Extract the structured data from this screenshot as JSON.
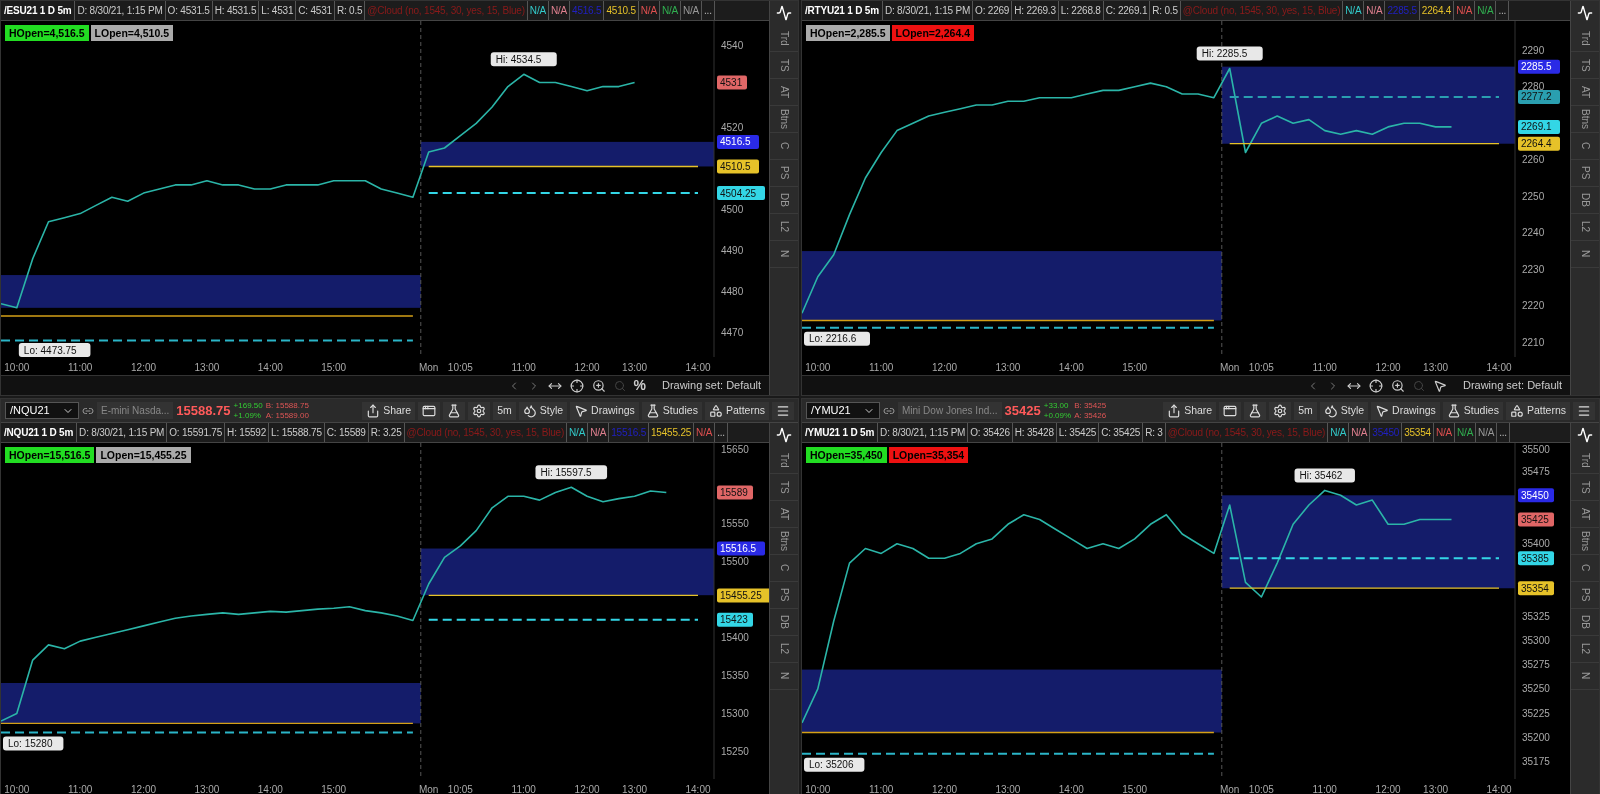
{
  "panels": [
    {
      "info": {
        "symbol": "/ESU21 1 D 5m",
        "items": [
          {
            "text": "D: 8/30/21, 1:15 PM",
            "color": "#cccccc"
          },
          {
            "text": "O: 4531.5",
            "color": "#cccccc"
          },
          {
            "text": "H: 4531.5",
            "color": "#cccccc"
          },
          {
            "text": "L: 4531",
            "color": "#cccccc"
          },
          {
            "text": "C: 4531",
            "color": "#cccccc"
          },
          {
            "text": "R: 0.5",
            "color": "#cccccc"
          },
          {
            "text": "@Cloud (no, 1545, 30, yes, 15, Blue)",
            "color": "#8b1a1a"
          },
          {
            "text": "N/A",
            "color": "#33cccc"
          },
          {
            "text": "N/A",
            "color": "#e08090"
          },
          {
            "text": "4516.5",
            "color": "#2020c0"
          },
          {
            "text": "4510.5",
            "color": "#e6c229"
          },
          {
            "text": "N/A",
            "color": "#e05050"
          },
          {
            "text": "N/A",
            "color": "#30b050"
          },
          {
            "text": "N/A",
            "color": "#999999"
          },
          {
            "text": "..."
          }
        ]
      },
      "badges": [
        {
          "text": "HOpen=4,516.5",
          "color": "#22dd22"
        },
        {
          "text": "LOpen=4,510.5",
          "color": "#aaaaaa"
        }
      ],
      "price_tag": {
        "text": "4531",
        "color": "#e06666"
      },
      "chart_data": {
        "type": "line",
        "categories": [
          null,
          "10:00",
          null,
          null,
          null,
          "11:00",
          null,
          null,
          null,
          "12:00",
          null,
          null,
          null,
          "13:00",
          null,
          null,
          null,
          "14:00",
          null,
          null,
          null,
          "15:00",
          null,
          null,
          null,
          null,
          null,
          "Mon",
          null,
          "10:05",
          null,
          null,
          null,
          "11:00",
          null,
          null,
          null,
          "12:00",
          null,
          null,
          "13:00",
          null,
          null,
          null,
          "14:00"
        ],
        "series": [
          {
            "color": "#2bb5a8",
            "values": [
              4477,
              4476,
              4488,
              4497,
              4498,
              4499,
              4501,
              4503,
              4502,
              4504,
              4505,
              4506,
              4506,
              4507,
              4506,
              4506,
              4505,
              4505,
              4506,
              4506,
              4506,
              4507,
              4507,
              4507,
              4505,
              4504,
              4503,
              4514,
              4515,
              4518,
              4521,
              4525,
              4530,
              4533,
              4531,
              4531,
              4530,
              4529,
              4530,
              4530,
              4531,
              null,
              null,
              null,
              null
            ]
          },
          {
            "color": "#d4a017",
            "values": [
              4474,
              4474,
              4474,
              4474,
              4474,
              4474,
              4474,
              4474,
              4474,
              4474,
              4474,
              4474,
              4474,
              4474,
              4474,
              4474,
              4474,
              4474,
              4474,
              4474,
              4474,
              4474,
              4474,
              4474,
              4474,
              4474,
              4474,
              null,
              null,
              null,
              null,
              null,
              null,
              null,
              null,
              null,
              null,
              null,
              null,
              null,
              null,
              null,
              null,
              null,
              null
            ]
          },
          {
            "color": "#2bb5c8",
            "line_style": "dashed",
            "values": [
              4468,
              4468,
              4468,
              4468,
              4468,
              4468,
              4468,
              4468,
              4468,
              4468,
              4468,
              4468,
              4468,
              4468,
              4468,
              4468,
              4468,
              4468,
              4468,
              4468,
              4468,
              4468,
              4468,
              4468,
              4468,
              4468,
              4468,
              null,
              null,
              null,
              null,
              null,
              null,
              null,
              null,
              null,
              null,
              null,
              null,
              null,
              null,
              null,
              null,
              null,
              null
            ]
          },
          {
            "color": "#e6c229",
            "values": [
              null,
              null,
              null,
              null,
              null,
              null,
              null,
              null,
              null,
              null,
              null,
              null,
              null,
              null,
              null,
              null,
              null,
              null,
              null,
              null,
              null,
              null,
              null,
              null,
              null,
              null,
              null,
              4510.5,
              4510.5,
              4510.5,
              4510.5,
              4510.5,
              4510.5,
              4510.5,
              4510.5,
              4510.5,
              4510.5,
              4510.5,
              4510.5,
              4510.5,
              4510.5,
              4510.5,
              4510.5,
              4510.5,
              4510.5
            ]
          },
          {
            "color": "#33d6e6",
            "line_style": "dashed",
            "values": [
              null,
              null,
              null,
              null,
              null,
              null,
              null,
              null,
              null,
              null,
              null,
              null,
              null,
              null,
              null,
              null,
              null,
              null,
              null,
              null,
              null,
              null,
              null,
              null,
              null,
              null,
              null,
              4504,
              4504,
              4504,
              4504,
              4504,
              4504,
              4504,
              4504,
              4504,
              4504,
              4504,
              4504,
              4504,
              4504,
              4504,
              4504,
              4504,
              4504
            ]
          }
        ],
        "ylim": [
          4464,
          4546
        ],
        "yticks": [
          4470,
          4480,
          4490,
          4500,
          4520,
          4540
        ],
        "bands": [
          {
            "axis": "y",
            "from": 4476,
            "to": 4484
          },
          {
            "axis": "y",
            "from": 4510.5,
            "to": 4516.5
          }
        ],
        "annotations": [
          "Hi: 4534.5",
          "Lo: 4473.75",
          "4516.5",
          "4510.5",
          "4504.25"
        ]
      },
      "side_tabs": [
        "Trd",
        "TS",
        "AT",
        "Btns",
        "C",
        "PS",
        "DB",
        "L2",
        "N"
      ],
      "footer": {
        "symbol": "%",
        "label": "Drawing set: Default"
      }
    },
    {
      "info": {
        "symbol": "/RTYU21 1 D 5m",
        "items": [
          {
            "text": "D: 8/30/21, 1:15 PM",
            "color": "#cccccc"
          },
          {
            "text": "O: 2269",
            "color": "#cccccc"
          },
          {
            "text": "H: 2269.3",
            "color": "#cccccc"
          },
          {
            "text": "L: 2268.8",
            "color": "#cccccc"
          },
          {
            "text": "C: 2269.1",
            "color": "#cccccc"
          },
          {
            "text": "R: 0.5",
            "color": "#cccccc"
          },
          {
            "text": "@Cloud (no, 1545, 30, yes, 15, Blue)",
            "color": "#8b1a1a"
          },
          {
            "text": "N/A",
            "color": "#33cccc"
          },
          {
            "text": "N/A",
            "color": "#e08090"
          },
          {
            "text": "2285.5",
            "color": "#2020c0"
          },
          {
            "text": "2264.4",
            "color": "#e6c229"
          },
          {
            "text": "N/A",
            "color": "#e05050"
          },
          {
            "text": "N/A",
            "color": "#30b050"
          },
          {
            "text": "..."
          }
        ]
      },
      "badges": [
        {
          "text": "HOpen=2,285.5",
          "color": "#aaaaaa"
        },
        {
          "text": "LOpen=2,264.4",
          "color": "#ee1111"
        }
      ],
      "price_tag": {
        "text": "2269.1",
        "color": "#33d6e6"
      },
      "chart_data": {
        "type": "line",
        "categories": [
          null,
          "10:00",
          null,
          null,
          null,
          "11:00",
          null,
          null,
          null,
          "12:00",
          null,
          null,
          null,
          "13:00",
          null,
          null,
          null,
          "14:00",
          null,
          null,
          null,
          "15:00",
          null,
          null,
          null,
          null,
          null,
          "Mon",
          null,
          "10:05",
          null,
          null,
          null,
          "11:00",
          null,
          null,
          null,
          "12:00",
          null,
          null,
          "13:00",
          null,
          null,
          null,
          "14:00"
        ],
        "series": [
          {
            "color": "#2bb5a8",
            "values": [
              2218,
              2228,
              2234,
              2245,
              2255,
              2262,
              2268,
              2270,
              2272,
              2273,
              2274,
              2275,
              2275,
              2276,
              2276,
              2277,
              2277,
              2277,
              2278,
              2279,
              2279,
              2280,
              2281,
              2280,
              2278,
              2278,
              2277,
              2285,
              2262,
              2270,
              2272,
              2270,
              2271,
              2268,
              2267,
              2268,
              2267,
              2269,
              2270,
              2270,
              2269,
              2269,
              null,
              null,
              null
            ]
          },
          {
            "color": "#d4a017",
            "values": [
              2216,
              2216,
              2216,
              2216,
              2216,
              2216,
              2216,
              2216,
              2216,
              2216,
              2216,
              2216,
              2216,
              2216,
              2216,
              2216,
              2216,
              2216,
              2216,
              2216,
              2216,
              2216,
              2216,
              2216,
              2216,
              2216,
              2216,
              null,
              null,
              null,
              null,
              null,
              null,
              null,
              null,
              null,
              null,
              null,
              null,
              null,
              null,
              null,
              null,
              null,
              null
            ]
          },
          {
            "color": "#2bb5c8",
            "line_style": "dashed",
            "values": [
              2214,
              2214,
              2214,
              2214,
              2214,
              2214,
              2214,
              2214,
              2214,
              2214,
              2214,
              2214,
              2214,
              2214,
              2214,
              2214,
              2214,
              2214,
              2214,
              2214,
              2214,
              2214,
              2214,
              2214,
              2214,
              2214,
              2214,
              null,
              null,
              null,
              null,
              null,
              null,
              null,
              null,
              null,
              null,
              null,
              null,
              null,
              null,
              null,
              null,
              null,
              null
            ]
          },
          {
            "color": "#e6c229",
            "values": [
              null,
              null,
              null,
              null,
              null,
              null,
              null,
              null,
              null,
              null,
              null,
              null,
              null,
              null,
              null,
              null,
              null,
              null,
              null,
              null,
              null,
              null,
              null,
              null,
              null,
              null,
              null,
              2264.4,
              2264.4,
              2264.4,
              2264.4,
              2264.4,
              2264.4,
              2264.4,
              2264.4,
              2264.4,
              2264.4,
              2264.4,
              2264.4,
              2264.4,
              2264.4,
              2264.4,
              2264.4,
              2264.4,
              2264.4
            ]
          },
          {
            "color": "#2a9fb0",
            "line_style": "dashed",
            "values": [
              null,
              null,
              null,
              null,
              null,
              null,
              null,
              null,
              null,
              null,
              null,
              null,
              null,
              null,
              null,
              null,
              null,
              null,
              null,
              null,
              null,
              null,
              null,
              null,
              null,
              null,
              null,
              2277.2,
              2277.2,
              2277.2,
              2277.2,
              2277.2,
              2277.2,
              2277.2,
              2277.2,
              2277.2,
              2277.2,
              2277.2,
              2277.2,
              2277.2,
              2277.2,
              2277.2,
              2277.2,
              2277.2,
              2277.2
            ]
          }
        ],
        "ylim": [
          2206,
          2298
        ],
        "yticks": [
          2210,
          2220,
          2230,
          2240,
          2250,
          2260,
          2280,
          2290
        ],
        "bands": [
          {
            "axis": "y",
            "from": 2216,
            "to": 2235
          },
          {
            "axis": "y",
            "from": 2264.4,
            "to": 2285.5
          }
        ],
        "annotations": [
          "Hi: 2285.5",
          "Lo: 2216.6",
          "2285.5",
          "2264.4",
          "2277.2"
        ]
      },
      "side_tabs": [
        "Trd",
        "TS",
        "AT",
        "Btns",
        "C",
        "PS",
        "DB",
        "L2",
        "N"
      ],
      "footer": {
        "label": "Drawing set: Default"
      }
    },
    {
      "toolbar": {
        "symbol": "/NQU21",
        "description": "E-mini Nasda...",
        "price": "15588.75",
        "change": "+169.50",
        "change_pct": "+1.09%",
        "bid": "B: 15588.75",
        "ask": "A: 15589.00",
        "buttons": [
          {
            "kind": "share",
            "text": "Share"
          },
          {
            "kind": "window"
          },
          {
            "kind": "flask"
          },
          {
            "kind": "gear"
          },
          {
            "kind": "plain",
            "text": "5m"
          },
          {
            "kind": "style",
            "text": "Style"
          },
          {
            "kind": "drawings",
            "text": "Drawings"
          },
          {
            "kind": "studies",
            "text": "Studies"
          },
          {
            "kind": "patterns",
            "text": "Patterns"
          },
          {
            "kind": "menu"
          }
        ]
      },
      "info": {
        "symbol": "/NQU21 1 D 5m",
        "items": [
          {
            "text": "D: 8/30/21, 1:15 PM",
            "color": "#cccccc"
          },
          {
            "text": "O: 15591.75",
            "color": "#cccccc"
          },
          {
            "text": "H: 15592",
            "color": "#cccccc"
          },
          {
            "text": "L: 15588.75",
            "color": "#cccccc"
          },
          {
            "text": "C: 15589",
            "color": "#cccccc"
          },
          {
            "text": "R: 3.25",
            "color": "#cccccc"
          },
          {
            "text": "@Cloud (no, 1545, 30, yes, 15, Blue)",
            "color": "#8b1a1a"
          },
          {
            "text": "N/A",
            "color": "#33cccc"
          },
          {
            "text": "N/A",
            "color": "#e08090"
          },
          {
            "text": "15516.5",
            "color": "#2020c0"
          },
          {
            "text": "15455.25",
            "color": "#e6c229"
          },
          {
            "text": "N/A",
            "color": "#e05050"
          },
          {
            "text": "..."
          }
        ]
      },
      "badges": [
        {
          "text": "HOpen=15,516.5",
          "color": "#22dd22"
        },
        {
          "text": "LOpen=15,455.25",
          "color": "#aaaaaa"
        }
      ],
      "price_tag": {
        "text": "15589",
        "color": "#e06666"
      },
      "chart_data": {
        "type": "line",
        "categories": [
          null,
          "10:00",
          null,
          null,
          null,
          "11:00",
          null,
          null,
          null,
          "12:00",
          null,
          null,
          null,
          "13:00",
          null,
          null,
          null,
          "14:00",
          null,
          null,
          null,
          "15:00",
          null,
          null,
          null,
          null,
          null,
          "Mon",
          null,
          "10:05",
          null,
          null,
          null,
          "11:00",
          null,
          null,
          null,
          "12:00",
          null,
          null,
          "13:00",
          null,
          null,
          null,
          "14:00"
        ],
        "series": [
          {
            "color": "#2bb5a8",
            "values": [
              15290,
              15300,
              15370,
              15390,
              15385,
              15395,
              15400,
              15405,
              15410,
              15415,
              15420,
              15425,
              15428,
              15430,
              15432,
              15430,
              15432,
              15434,
              15433,
              15435,
              15437,
              15438,
              15440,
              15435,
              15432,
              15428,
              15422,
              15470,
              15505,
              15520,
              15540,
              15570,
              15585,
              15585,
              15580,
              15590,
              15597,
              15585,
              15578,
              15582,
              15585,
              15592,
              15590,
              null,
              null
            ]
          },
          {
            "color": "#d4a017",
            "values": [
              15287,
              15287,
              15287,
              15287,
              15287,
              15287,
              15287,
              15287,
              15287,
              15287,
              15287,
              15287,
              15287,
              15287,
              15287,
              15287,
              15287,
              15287,
              15287,
              15287,
              15287,
              15287,
              15287,
              15287,
              15287,
              15287,
              15287,
              null,
              null,
              null,
              null,
              null,
              null,
              null,
              null,
              null,
              null,
              null,
              null,
              null,
              null,
              null,
              null,
              null,
              null
            ]
          },
          {
            "color": "#2bb5c8",
            "line_style": "dashed",
            "values": [
              15275,
              15275,
              15275,
              15275,
              15275,
              15275,
              15275,
              15275,
              15275,
              15275,
              15275,
              15275,
              15275,
              15275,
              15275,
              15275,
              15275,
              15275,
              15275,
              15275,
              15275,
              15275,
              15275,
              15275,
              15275,
              15275,
              15275,
              null,
              null,
              null,
              null,
              null,
              null,
              null,
              null,
              null,
              null,
              null,
              null,
              null,
              null,
              null,
              null,
              null,
              null
            ]
          },
          {
            "color": "#e6c229",
            "values": [
              null,
              null,
              null,
              null,
              null,
              null,
              null,
              null,
              null,
              null,
              null,
              null,
              null,
              null,
              null,
              null,
              null,
              null,
              null,
              null,
              null,
              null,
              null,
              null,
              null,
              null,
              null,
              15455,
              15455,
              15455,
              15455,
              15455,
              15455,
              15455,
              15455,
              15455,
              15455,
              15455,
              15455,
              15455,
              15455,
              15455,
              15455,
              15455,
              15455
            ]
          },
          {
            "color": "#33d6e6",
            "line_style": "dashed",
            "values": [
              null,
              null,
              null,
              null,
              null,
              null,
              null,
              null,
              null,
              null,
              null,
              null,
              null,
              null,
              null,
              null,
              null,
              null,
              null,
              null,
              null,
              null,
              null,
              null,
              null,
              null,
              null,
              15423,
              15423,
              15423,
              15423,
              15423,
              15423,
              15423,
              15423,
              15423,
              15423,
              15423,
              15423,
              15423,
              15423,
              15423,
              15423,
              15423,
              15423
            ]
          }
        ],
        "ylim": [
          15214,
          15655
        ],
        "yticks": [
          15250,
          15300,
          15350,
          15400,
          15500,
          15550,
          15650
        ],
        "bands": [
          {
            "axis": "y",
            "from": 15287,
            "to": 15340
          },
          {
            "axis": "y",
            "from": 15455.25,
            "to": 15516.5
          }
        ],
        "annotations": [
          "Hi: 15597.5",
          "Lo: 15280",
          "15516.5",
          "15455.25",
          "15423"
        ]
      },
      "side_tabs": [
        "Trd",
        "TS",
        "AT",
        "Btns",
        "C",
        "PS",
        "DB",
        "L2",
        "N"
      ]
    },
    {
      "toolbar": {
        "symbol": "/YMU21",
        "description": "Mini Dow Jones Ind...",
        "price": "35425",
        "change": "+33.00",
        "change_pct": "+0.09%",
        "bid": "B: 35425",
        "ask": "A: 35426",
        "buttons": [
          {
            "kind": "share",
            "text": "Share"
          },
          {
            "kind": "window"
          },
          {
            "kind": "flask"
          },
          {
            "kind": "gear"
          },
          {
            "kind": "plain",
            "text": "5m"
          },
          {
            "kind": "style",
            "text": "Style"
          },
          {
            "kind": "drawings",
            "text": "Drawings"
          },
          {
            "kind": "studies",
            "text": "Studies"
          },
          {
            "kind": "patterns",
            "text": "Patterns"
          },
          {
            "kind": "menu"
          }
        ]
      },
      "info": {
        "symbol": "/YMU21 1 D 5m",
        "items": [
          {
            "text": "D: 8/30/21, 1:15 PM",
            "color": "#cccccc"
          },
          {
            "text": "O: 35426",
            "color": "#cccccc"
          },
          {
            "text": "H: 35428",
            "color": "#cccccc"
          },
          {
            "text": "L: 35425",
            "color": "#cccccc"
          },
          {
            "text": "C: 35425",
            "color": "#cccccc"
          },
          {
            "text": "R: 3",
            "color": "#cccccc"
          },
          {
            "text": "@Cloud (no, 1545, 30, yes, 15, Blue)",
            "color": "#8b1a1a"
          },
          {
            "text": "N/A",
            "color": "#33cccc"
          },
          {
            "text": "N/A",
            "color": "#e08090"
          },
          {
            "text": "35450",
            "color": "#2020c0"
          },
          {
            "text": "35354",
            "color": "#e6c229"
          },
          {
            "text": "N/A",
            "color": "#e05050"
          },
          {
            "text": "N/A",
            "color": "#30b050"
          },
          {
            "text": "N/A",
            "color": "#999999"
          },
          {
            "text": "..."
          }
        ]
      },
      "badges": [
        {
          "text": "HOpen=35,450",
          "color": "#22dd22"
        },
        {
          "text": "LOpen=35,354",
          "color": "#ee1111"
        }
      ],
      "price_tag": {
        "text": "35425",
        "color": "#e06666"
      },
      "chart_data": {
        "type": "line",
        "categories": [
          null,
          "10:00",
          null,
          null,
          null,
          "11:00",
          null,
          null,
          null,
          "12:00",
          null,
          null,
          null,
          "13:00",
          null,
          null,
          null,
          "14:00",
          null,
          null,
          null,
          "15:00",
          null,
          null,
          null,
          null,
          null,
          "Mon",
          null,
          "10:05",
          null,
          null,
          null,
          "11:00",
          null,
          null,
          null,
          "12:00",
          null,
          null,
          "13:00",
          null,
          null,
          null,
          "14:00"
        ],
        "series": [
          {
            "color": "#2bb5a8",
            "values": [
              35215,
              35250,
              35320,
              35380,
              35395,
              35390,
              35400,
              35395,
              35385,
              35385,
              35390,
              35400,
              35405,
              35420,
              35430,
              35425,
              35415,
              35405,
              35395,
              35400,
              35395,
              35405,
              35420,
              35430,
              35410,
              35400,
              35390,
              35440,
              35360,
              35345,
              35380,
              35420,
              35440,
              35455,
              35450,
              35440,
              35445,
              35420,
              35420,
              35425,
              35425,
              35425,
              null,
              null,
              null
            ]
          },
          {
            "color": "#d4a017",
            "values": [
              35205,
              35205,
              35205,
              35205,
              35205,
              35205,
              35205,
              35205,
              35205,
              35205,
              35205,
              35205,
              35205,
              35205,
              35205,
              35205,
              35205,
              35205,
              35205,
              35205,
              35205,
              35205,
              35205,
              35205,
              35205,
              35205,
              35205,
              null,
              null,
              null,
              null,
              null,
              null,
              null,
              null,
              null,
              null,
              null,
              null,
              null,
              null,
              null,
              null,
              null,
              null
            ]
          },
          {
            "color": "#2bb5c8",
            "line_style": "dashed",
            "values": [
              35183,
              35183,
              35183,
              35183,
              35183,
              35183,
              35183,
              35183,
              35183,
              35183,
              35183,
              35183,
              35183,
              35183,
              35183,
              35183,
              35183,
              35183,
              35183,
              35183,
              35183,
              35183,
              35183,
              35183,
              35183,
              35183,
              35183,
              null,
              null,
              null,
              null,
              null,
              null,
              null,
              null,
              null,
              null,
              null,
              null,
              null,
              null,
              null,
              null,
              null,
              null
            ]
          },
          {
            "color": "#e6c229",
            "values": [
              null,
              null,
              null,
              null,
              null,
              null,
              null,
              null,
              null,
              null,
              null,
              null,
              null,
              null,
              null,
              null,
              null,
              null,
              null,
              null,
              null,
              null,
              null,
              null,
              null,
              null,
              null,
              35354,
              35354,
              35354,
              35354,
              35354,
              35354,
              35354,
              35354,
              35354,
              35354,
              35354,
              35354,
              35354,
              35354,
              35354,
              35354,
              35354,
              35354
            ]
          },
          {
            "color": "#33d6e6",
            "line_style": "dashed",
            "values": [
              null,
              null,
              null,
              null,
              null,
              null,
              null,
              null,
              null,
              null,
              null,
              null,
              null,
              null,
              null,
              null,
              null,
              null,
              null,
              null,
              null,
              null,
              null,
              null,
              null,
              null,
              null,
              35385,
              35385,
              35385,
              35385,
              35385,
              35385,
              35385,
              35385,
              35385,
              35385,
              35385,
              35385,
              35385,
              35385,
              35385,
              35385,
              35385,
              35385
            ]
          }
        ],
        "ylim": [
          35157,
          35504
        ],
        "yticks": [
          35175,
          35200,
          35225,
          35250,
          35275,
          35300,
          35325,
          35400,
          35475,
          35500
        ],
        "bands": [
          {
            "axis": "y",
            "from": 35205,
            "to": 35270
          },
          {
            "axis": "y",
            "from": 35354,
            "to": 35450
          }
        ],
        "annotations": [
          "Hi: 35462",
          "Lo: 35206",
          "35450",
          "35354",
          "35385"
        ]
      },
      "side_tabs": [
        "Trd",
        "TS",
        "AT",
        "Btns",
        "C",
        "PS",
        "DB",
        "L2",
        "N"
      ]
    }
  ]
}
